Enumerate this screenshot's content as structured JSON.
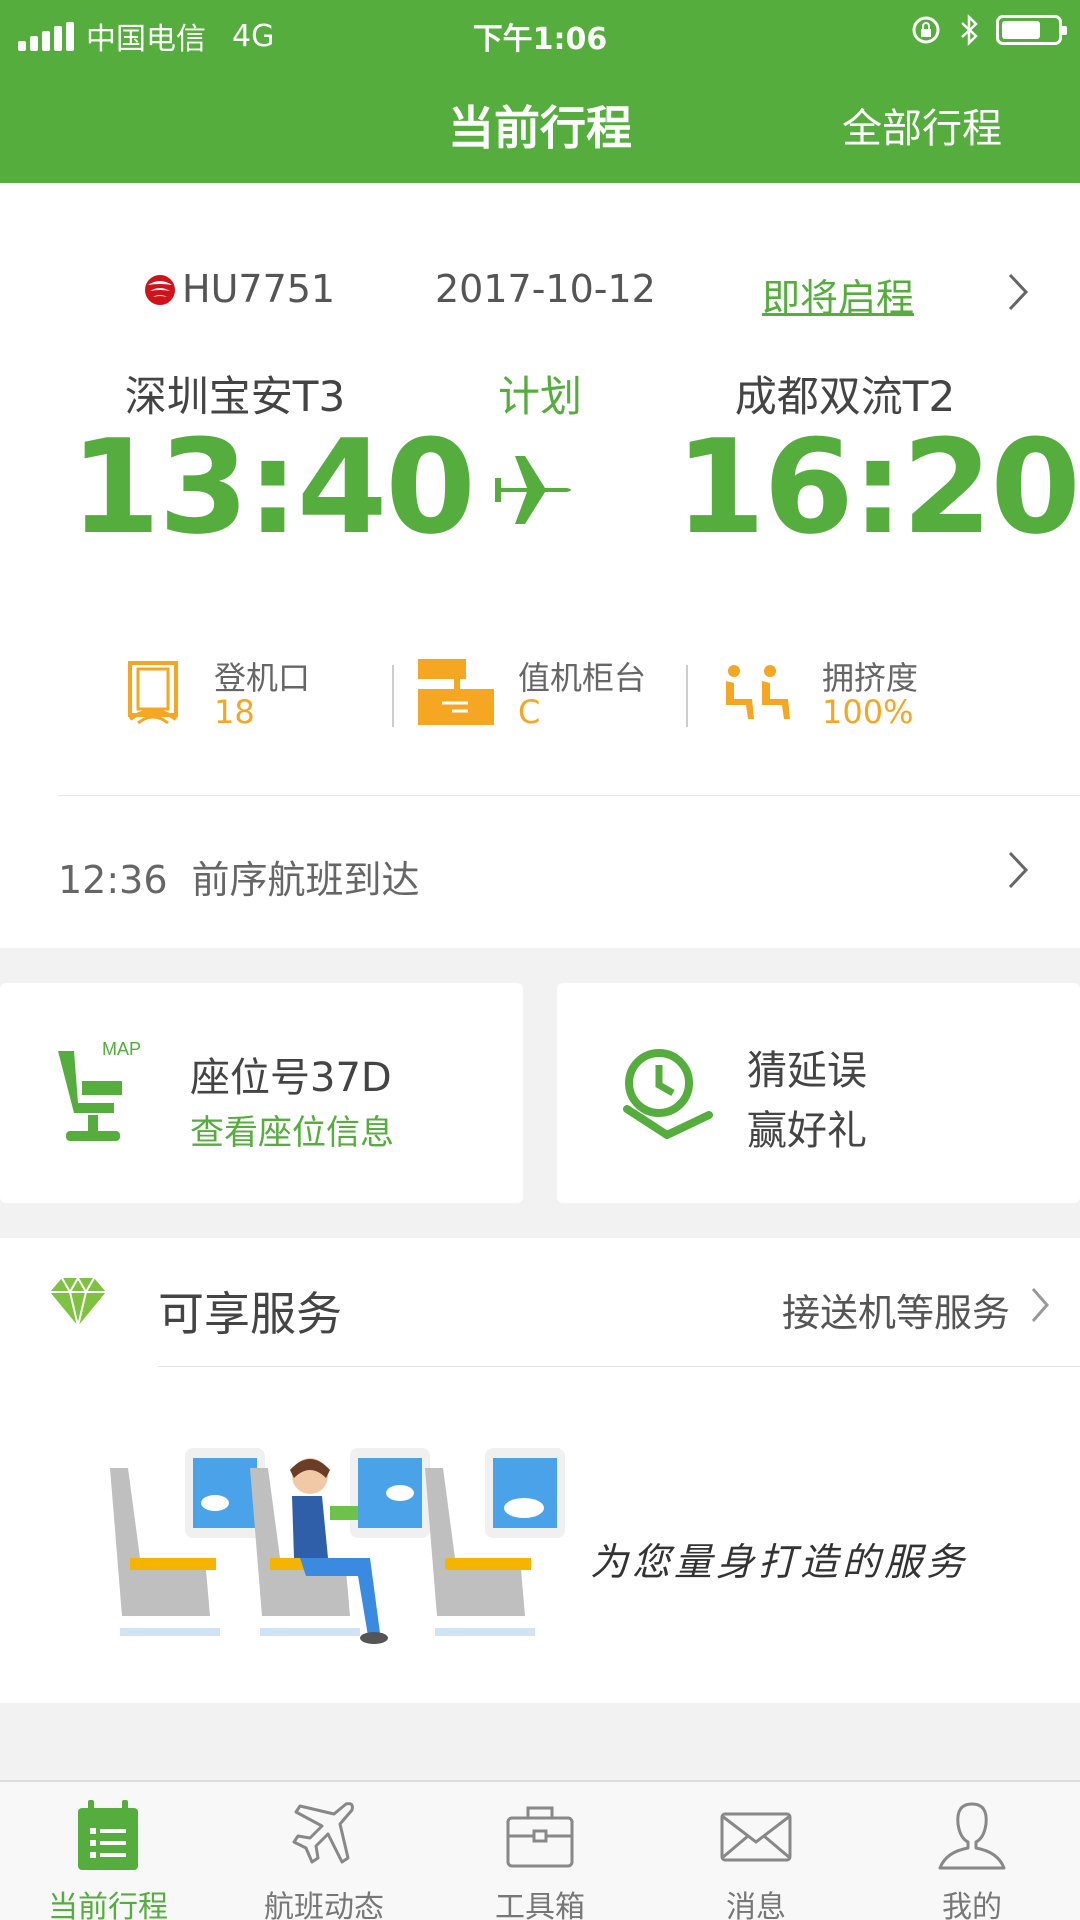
{
  "status_bar": {
    "carrier": "中国电信",
    "network": "4G",
    "time": "下午1:06"
  },
  "header": {
    "title": "当前行程",
    "all_trips": "全部行程"
  },
  "flight": {
    "number": "HU7751",
    "date": "2017-10-12",
    "status": "即将启程",
    "departure": {
      "airport": "深圳宝安T3",
      "time": "13:40"
    },
    "arrival": {
      "airport": "成都双流T2",
      "time": "16:20"
    },
    "plan_label": "计划",
    "gate": {
      "label": "登机口",
      "value": "18"
    },
    "checkin": {
      "label": "值机柜台",
      "value": "C"
    },
    "crowd": {
      "label": "拥挤度",
      "value": "100%"
    },
    "previous": {
      "time": "12:36",
      "text": "前序航班到达"
    }
  },
  "seat_card": {
    "seat": "座位号37D",
    "link": "查看座位信息",
    "map_tag": "MAP"
  },
  "delay_card": {
    "line1": "猜延误",
    "line2": "赢好礼"
  },
  "services": {
    "title": "可享服务",
    "more": "接送机等服务",
    "slogan": "为您量身打造的服务"
  },
  "tabs": [
    {
      "label": "当前行程",
      "icon": "calendar-list-icon",
      "active": true
    },
    {
      "label": "航班动态",
      "icon": "airplane-icon"
    },
    {
      "label": "工具箱",
      "icon": "toolbox-icon"
    },
    {
      "label": "消息",
      "icon": "envelope-icon"
    },
    {
      "label": "我的",
      "icon": "user-icon"
    }
  ],
  "colors": {
    "brand_green": "#55ad3e",
    "accent_orange": "#f5a623"
  }
}
